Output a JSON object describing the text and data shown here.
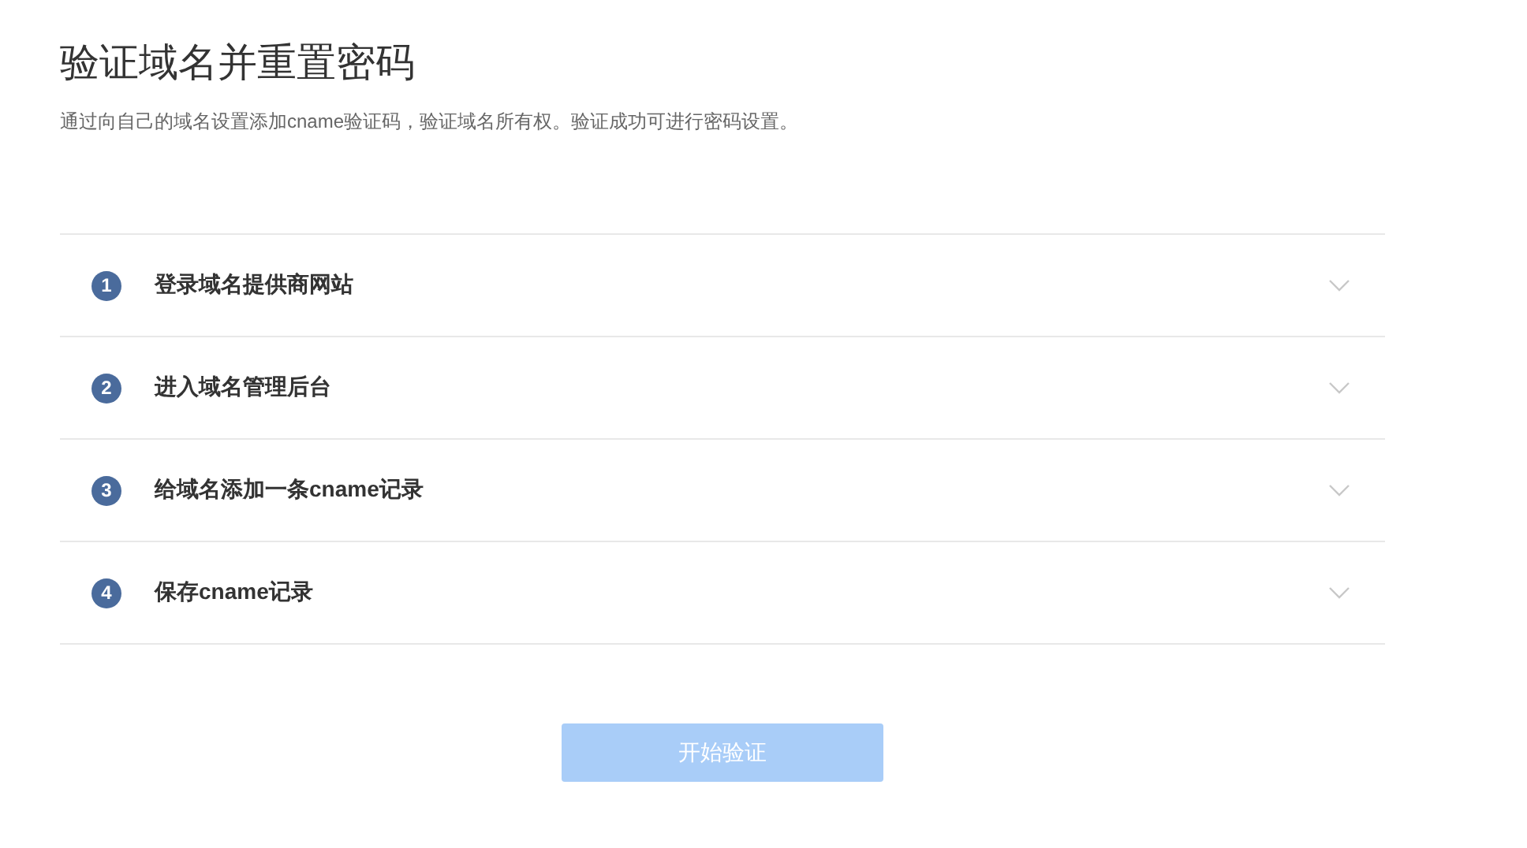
{
  "title": "验证域名并重置密码",
  "subtitle": "通过向自己的域名设置添加cname验证码，验证域名所有权。验证成功可进行密码设置。",
  "steps": [
    {
      "number": "1",
      "label": "登录域名提供商网站",
      "expanded": false
    },
    {
      "number": "2",
      "label": "进入域名管理后台",
      "expanded": false
    },
    {
      "number": "3",
      "label": "给域名添加一条cname记录",
      "expanded": false
    },
    {
      "number": "4",
      "label": "保存cname记录",
      "expanded": false
    }
  ],
  "button": {
    "label": "开始验证",
    "disabled": true
  }
}
